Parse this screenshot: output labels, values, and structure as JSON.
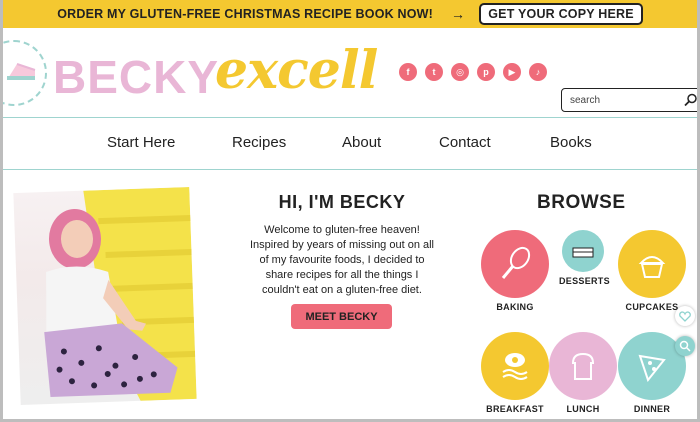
{
  "promo": {
    "text": "ORDER MY GLUTEN-FREE CHRISTMAS RECIPE BOOK NOW!",
    "arrow": "→",
    "cta": "GET YOUR COPY HERE"
  },
  "logo": {
    "first": "BECKY",
    "second": "excell"
  },
  "socials": [
    {
      "name": "facebook-icon",
      "glyph": "f"
    },
    {
      "name": "twitter-icon",
      "glyph": "t"
    },
    {
      "name": "instagram-icon",
      "glyph": "◎"
    },
    {
      "name": "pinterest-icon",
      "glyph": "p"
    },
    {
      "name": "youtube-icon",
      "glyph": "▶"
    },
    {
      "name": "tiktok-icon",
      "glyph": "♪"
    }
  ],
  "search": {
    "placeholder": "search"
  },
  "nav": [
    "Start Here",
    "Recipes",
    "About",
    "Contact",
    "Books"
  ],
  "intro": {
    "title": "HI, I'M BECKY",
    "body": "Welcome to gluten-free heaven! Inspired by years of missing out on all of my favourite foods, I decided to share recipes for all the things I couldn't eat on a gluten-free diet.",
    "button": "MEET BECKY"
  },
  "browse": {
    "title": "BROWSE",
    "categories": [
      {
        "label": "BAKING",
        "color": "#ef6b7a"
      },
      {
        "label": "DESSERTS",
        "color": "#8fd3cf"
      },
      {
        "label": "CUPCAKES",
        "color": "#f4c830"
      },
      {
        "label": "BREAKFAST",
        "color": "#f4c830"
      },
      {
        "label": "LUNCH",
        "color": "#e9b6d6"
      },
      {
        "label": "DINNER",
        "color": "#8fd3cf"
      }
    ]
  },
  "colors": {
    "yellow": "#f4c830",
    "pink": "#ef6b7a",
    "lightpink": "#e9b6d6",
    "teal": "#8fd3cf"
  }
}
